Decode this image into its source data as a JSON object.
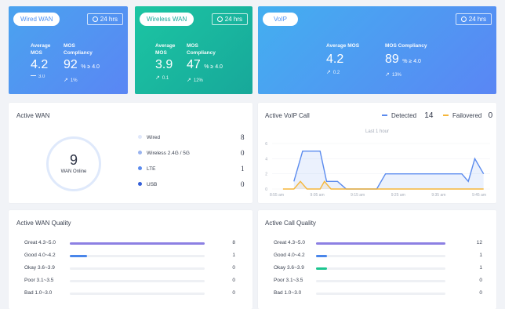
{
  "wired_wan": {
    "pill": "Wired WAN",
    "period": "24 hrs",
    "avg_label_1": "Average",
    "avg_label_2": "MOS",
    "avg_value": "4.2",
    "avg_sub": "3.0",
    "comp_label_1": "MOS",
    "comp_label_2": "Compliancy",
    "comp_value": "92",
    "comp_unit": "% ≥ 4.0",
    "comp_sub": "1%"
  },
  "wireless_wan": {
    "pill": "Wireless WAN",
    "period": "24 hrs",
    "avg_label_1": "Average",
    "avg_label_2": "MOS",
    "avg_value": "3.9",
    "avg_sub": "0.1",
    "comp_label_1": "MOS",
    "comp_label_2": "Compliancy",
    "comp_value": "47",
    "comp_unit": "% ≥ 4.0",
    "comp_sub": "12%"
  },
  "voip": {
    "pill": "VoIP",
    "period": "24 hrs",
    "avg_label": "Average MOS",
    "avg_value": "4.2",
    "avg_sub": "0.2",
    "comp_label": "MOS Compliancy",
    "comp_value": "89",
    "comp_unit": "% ≥ 4.0",
    "comp_sub": "13%"
  },
  "active_wan": {
    "title": "Active WAN",
    "total": "9",
    "total_label": "WAN Online",
    "items": [
      {
        "label": "Wired",
        "value": "8",
        "color": "#dfe7fa"
      },
      {
        "label": "Wireless 2.4G / 5G",
        "value": "0",
        "color": "#9ab4ef"
      },
      {
        "label": "LTE",
        "value": "1",
        "color": "#5b8bee"
      },
      {
        "label": "USB",
        "value": "0",
        "color": "#3560d8"
      }
    ]
  },
  "active_voip": {
    "title": "Active VoIP Call",
    "detected_label": "Detected",
    "detected_value": "14",
    "detected_color": "#5b8bee",
    "failovered_label": "Failovered",
    "failovered_value": "0",
    "failovered_color": "#f5b63a"
  },
  "chart_data": {
    "type": "area",
    "title": "Last 1 hour",
    "ylim": [
      0,
      6
    ],
    "yticks": [
      "6",
      "4",
      "2",
      "0"
    ],
    "xticks": [
      "8:55 am",
      "9:05 am",
      "9:15 am",
      "9:25 am",
      "9:35 am",
      "9:45 am"
    ],
    "series": [
      {
        "name": "Detected",
        "color": "#5b8bee",
        "points": [
          [
            0.1,
            1
          ],
          [
            0.14,
            5
          ],
          [
            0.22,
            5
          ],
          [
            0.25,
            1
          ],
          [
            0.3,
            1
          ],
          [
            0.34,
            0
          ],
          [
            0.4,
            0
          ],
          [
            0.48,
            0
          ],
          [
            0.52,
            2
          ],
          [
            0.6,
            2
          ],
          [
            0.7,
            2
          ],
          [
            0.8,
            2
          ],
          [
            0.87,
            2
          ],
          [
            0.9,
            1
          ],
          [
            0.93,
            4
          ],
          [
            0.97,
            2
          ]
        ]
      },
      {
        "name": "Failovered",
        "color": "#f5b63a",
        "points": [
          [
            0.05,
            0
          ],
          [
            0.1,
            0
          ],
          [
            0.13,
            1
          ],
          [
            0.16,
            0
          ],
          [
            0.22,
            0
          ],
          [
            0.24,
            1
          ],
          [
            0.27,
            0
          ],
          [
            0.4,
            0
          ],
          [
            0.6,
            0
          ],
          [
            0.8,
            0
          ],
          [
            0.97,
            0
          ]
        ]
      }
    ]
  },
  "wan_quality": {
    "title": "Active WAN Quality",
    "bar_max": 8,
    "rows": [
      {
        "label": "Great 4.3~5.0",
        "value": "8",
        "color": "#8c80e3"
      },
      {
        "label": "Good 4.0~4.2",
        "value": "1",
        "color": "#4a86ea"
      },
      {
        "label": "Okay 3.6~3.9",
        "value": "0",
        "color": "#1cc58f"
      },
      {
        "label": "Poor 3.1~3.5",
        "value": "0",
        "color": "#f5b63a"
      },
      {
        "label": "Bad 1.0~3.0",
        "value": "0",
        "color": "#ef5b5b"
      }
    ]
  },
  "call_quality": {
    "title": "Active Call Quality",
    "bar_max": 12,
    "rows": [
      {
        "label": "Great 4.3~5.0",
        "value": "12",
        "color": "#8c80e3"
      },
      {
        "label": "Good 4.0~4.2",
        "value": "1",
        "color": "#4a86ea"
      },
      {
        "label": "Okay 3.6~3.9",
        "value": "1",
        "color": "#1cc58f"
      },
      {
        "label": "Poor 3.1~3.5",
        "value": "0",
        "color": "#f5b63a"
      },
      {
        "label": "Bad 1.0~3.0",
        "value": "0",
        "color": "#ef5b5b"
      }
    ]
  }
}
